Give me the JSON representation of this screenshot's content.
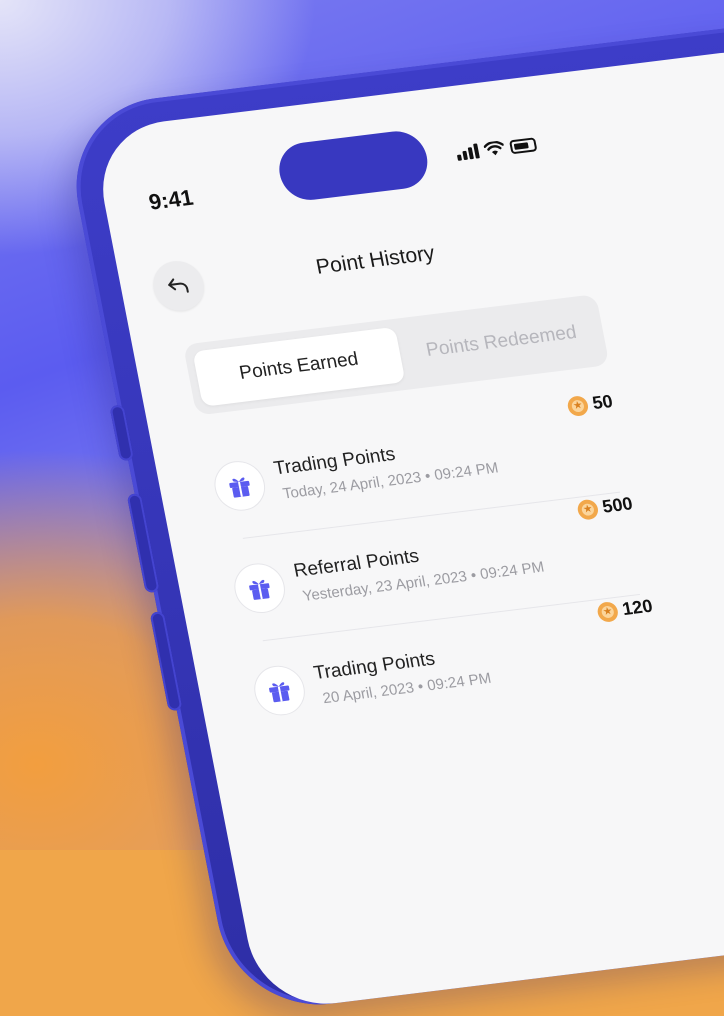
{
  "status_bar": {
    "time": "9:41"
  },
  "header": {
    "title": "Point History"
  },
  "tabs": [
    {
      "label": "Points Earned",
      "active": true
    },
    {
      "label": "Points Redeemed",
      "active": false
    }
  ],
  "history": [
    {
      "title": "Trading Points",
      "date": "Today, 24 April, 2023 • 09:24 PM",
      "points": "50"
    },
    {
      "title": "Referral Points",
      "date": "Yesterday, 23 April, 2023 • 09:24 PM",
      "points": "500"
    },
    {
      "title": "Trading Points",
      "date": "20 April, 2023 • 09:24 PM",
      "points": "120"
    }
  ],
  "colors": {
    "phone": "#3434b4",
    "accent": "#5b5cf0",
    "coin": "#f2a84b",
    "background_warm": "#f29e3f"
  },
  "icons": {
    "back": "undo-arrow-icon",
    "item": "gift-icon",
    "points": "coin-icon"
  }
}
